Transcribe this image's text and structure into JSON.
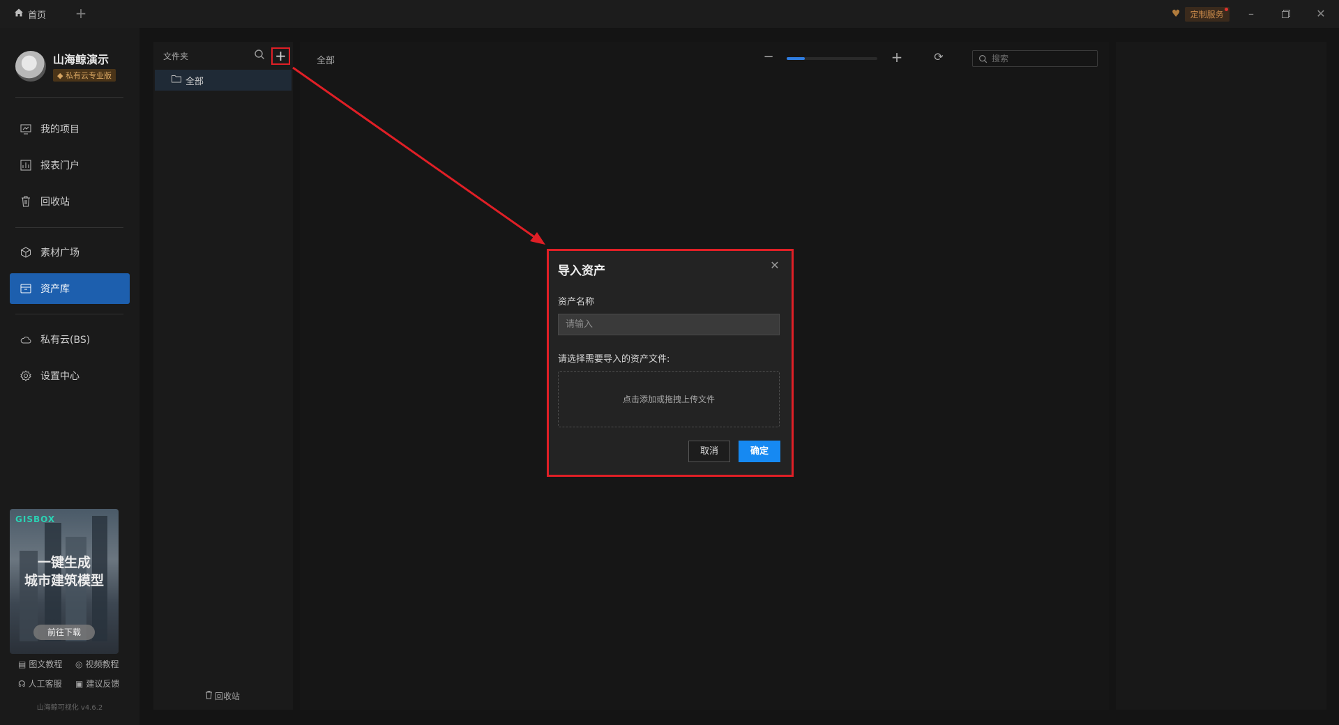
{
  "titlebar": {
    "home_tab_label": "首页",
    "new_tab_icon": "plus-icon",
    "custom_service_label": "定制服务",
    "window_controls": [
      "minimize-icon",
      "restore-icon",
      "close-icon"
    ]
  },
  "sidebar": {
    "brand_name": "山海鲸演示",
    "brand_badge": "◆ 私有云专业版",
    "nav": [
      {
        "label": "我的项目",
        "icon": "chart-board-icon"
      },
      {
        "label": "报表门户",
        "icon": "report-icon"
      },
      {
        "label": "回收站",
        "icon": "trash-icon"
      },
      {
        "label": "素材广场",
        "icon": "cube-icon"
      },
      {
        "label": "资产库",
        "icon": "archive-icon",
        "active": true
      },
      {
        "label": "私有云(BS)",
        "icon": "cloud-icon"
      },
      {
        "label": "设置中心",
        "icon": "gear-icon"
      }
    ],
    "promo": {
      "brand": "GISBOX",
      "title_line1": "一键生成",
      "title_line2": "城市建筑模型",
      "download_label": "前往下载"
    },
    "help": {
      "doc_tutorial": "图文教程",
      "video_tutorial": "视频教程",
      "support": "人工客服",
      "feedback": "建议反馈"
    },
    "version": "山海鲸可视化 v4.6.2"
  },
  "folder_panel": {
    "title": "文件夹",
    "all_label": "全部",
    "recycle_label": "回收站"
  },
  "main": {
    "breadcrumb": "全部",
    "zoom_level": 0.2,
    "search_placeholder": "搜索"
  },
  "dialog": {
    "title": "导入资产",
    "name_label": "资产名称",
    "name_placeholder": "请输入",
    "file_label": "请选择需要导入的资产文件:",
    "dropzone_text": "点击添加或拖拽上传文件",
    "cancel_label": "取消",
    "confirm_label": "确定"
  },
  "colors": {
    "accent": "#1689f2",
    "active_nav": "#1d5fae",
    "annotation_red": "#e01f26"
  }
}
